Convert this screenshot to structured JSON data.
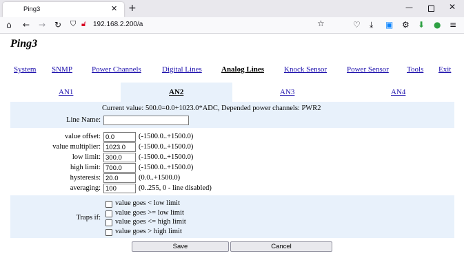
{
  "browser": {
    "tab_title": "Ping3",
    "url": "192.168.2.200/a"
  },
  "page": {
    "logo": "Ping3",
    "main_nav": [
      {
        "label": "System"
      },
      {
        "label": "SNMP"
      },
      {
        "label": "Power Channels"
      },
      {
        "label": "Digital Lines"
      },
      {
        "label": "Analog Lines",
        "active": true
      },
      {
        "label": "Knock Sensor"
      },
      {
        "label": "Power Sensor"
      },
      {
        "label": "Tools"
      },
      {
        "label": "Exit"
      }
    ],
    "sub_nav": [
      {
        "label": "AN1"
      },
      {
        "label": "AN2",
        "active": true
      },
      {
        "label": "AN3"
      },
      {
        "label": "AN4"
      }
    ],
    "current_value": "Current value: 500.0=0.0+1023.0*ADC, Depended power channels: PWR2",
    "line_name": {
      "label": "Line Name:",
      "value": ""
    },
    "fields": [
      {
        "label": "value offset:",
        "value": "0.0",
        "range": "(-1500.0..+1500.0)"
      },
      {
        "label": "value multiplier:",
        "value": "1023.0",
        "range": "(-1500.0..+1500.0)"
      },
      {
        "label": "low limit:",
        "value": "300.0",
        "range": "(-1500.0..+1500.0)"
      },
      {
        "label": "high limit:",
        "value": "700.0",
        "range": "(-1500.0..+1500.0)"
      },
      {
        "label": "hysteresis:",
        "value": "20.0",
        "range": "(0.0..+1500.0)"
      },
      {
        "label": "averaging:",
        "value": "100",
        "range": "(0..255, 0 - line disabled)"
      }
    ],
    "traps": {
      "label": "Traps if:",
      "options": [
        {
          "label": "value goes < low limit",
          "checked": false
        },
        {
          "label": "value goes >= low limit",
          "checked": false
        },
        {
          "label": "value goes <= high limit",
          "checked": false
        },
        {
          "label": "value goes > high limit",
          "checked": false
        }
      ]
    },
    "buttons": {
      "save": "Save",
      "cancel": "Cancel"
    }
  },
  "colors": {
    "link": "#1a0dab",
    "band": "#e8f1fb"
  }
}
